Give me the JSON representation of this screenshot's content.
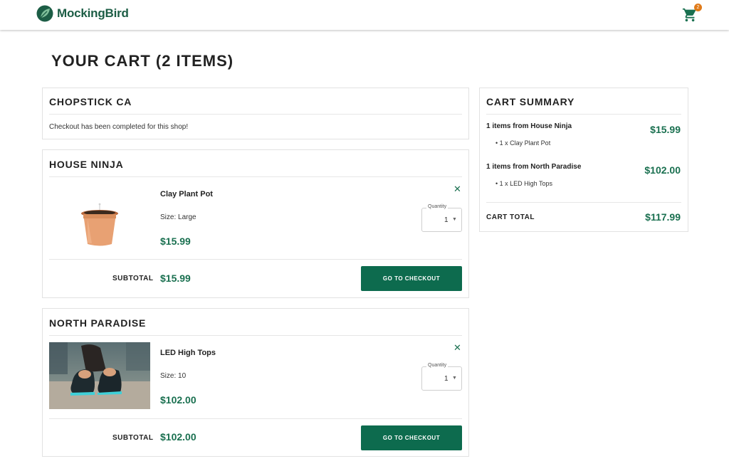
{
  "header": {
    "brand": "MockingBird",
    "cart_count": "2",
    "brand_color": "#1c5d45",
    "badge_color": "#e07b1a"
  },
  "page": {
    "title": "YOUR CART (2 ITEMS)"
  },
  "shops": [
    {
      "name": "CHOPSTICK CA",
      "note": "Checkout has been completed for this shop!"
    },
    {
      "name": "HOUSE NINJA",
      "item": {
        "name": "Clay Plant Pot",
        "size": "Size: Large",
        "price": "$15.99",
        "quantity_label": "Quantity",
        "quantity": "1",
        "image_icon": "clay-pot-icon"
      },
      "subtotal_label": "SUBTOTAL",
      "subtotal": "$15.99",
      "checkout_label": "GO TO CHECKOUT"
    },
    {
      "name": "NORTH PARADISE",
      "item": {
        "name": "LED High Tops",
        "size": "Size: 10",
        "price": "$102.00",
        "quantity_label": "Quantity",
        "quantity": "1",
        "image_icon": "sneakers-photo"
      },
      "subtotal_label": "SUBTOTAL",
      "subtotal": "$102.00",
      "checkout_label": "GO TO CHECKOUT"
    }
  ],
  "summary": {
    "title": "CART SUMMARY",
    "groups": [
      {
        "line": "1 items from House Ninja",
        "bullet": "1 x Clay Plant Pot",
        "price": "$15.99"
      },
      {
        "line": "1 items from North Paradise",
        "bullet": "1 x LED High Tops",
        "price": "$102.00"
      }
    ],
    "total_label": "CART TOTAL",
    "total": "$117.99"
  },
  "colors": {
    "accent": "#0d6b4e",
    "price": "#1a7050"
  }
}
